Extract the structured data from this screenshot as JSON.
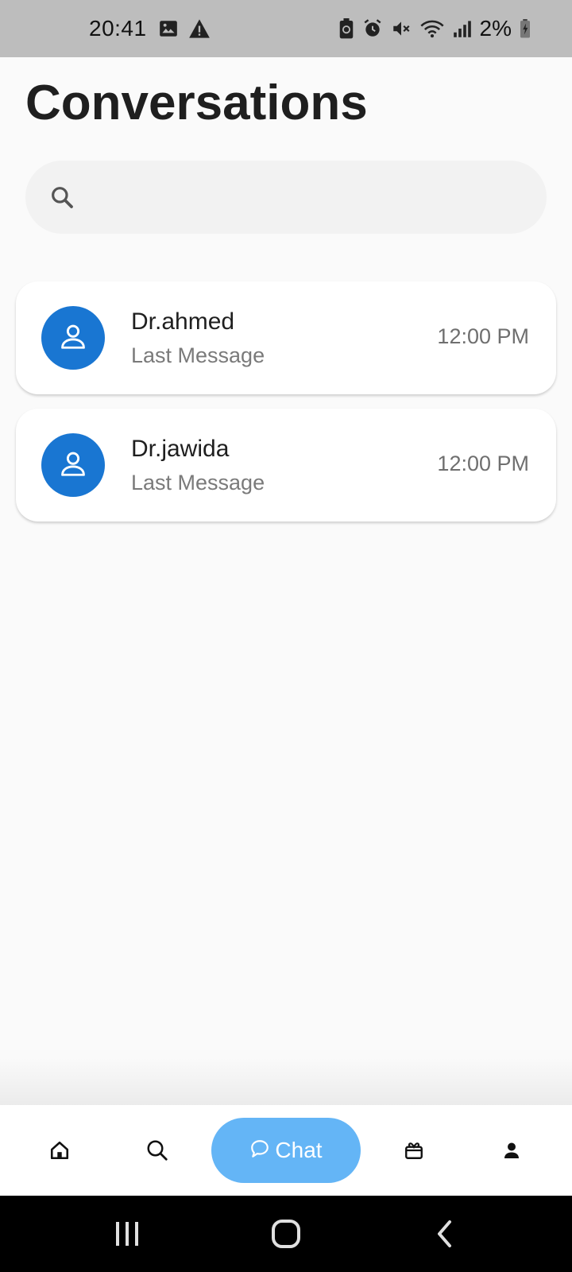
{
  "status_bar": {
    "time": "20:41",
    "battery_text": "2%",
    "left_icons": [
      "image-icon",
      "warning-icon"
    ],
    "right_icons": [
      "battery-saver-icon",
      "alarm-icon",
      "mute-icon",
      "wifi-icon",
      "signal-icon",
      "battery-icon"
    ]
  },
  "page": {
    "title": "Conversations"
  },
  "search": {
    "icon": "search-icon",
    "placeholder": "",
    "value": ""
  },
  "conversations": [
    {
      "name": "Dr.ahmed",
      "last_message": "Last Message",
      "time": "12:00 PM",
      "avatar_icon": "person-icon"
    },
    {
      "name": "Dr.jawida",
      "last_message": "Last Message",
      "time": "12:00 PM",
      "avatar_icon": "person-icon"
    }
  ],
  "bottom_nav": {
    "items": [
      {
        "icon": "home-icon"
      },
      {
        "icon": "search-icon"
      },
      {
        "icon": "chat-bubble-icon",
        "label": "Chat",
        "active": true
      },
      {
        "icon": "gift-icon"
      },
      {
        "icon": "profile-icon"
      }
    ]
  },
  "system_nav": {
    "buttons": [
      "recents-icon",
      "home-circle-icon",
      "back-icon"
    ]
  },
  "colors": {
    "status_bar_bg": "#bdbdbd",
    "page_bg": "#fafafa",
    "avatar_bg": "#1976d2",
    "active_nav_pill": "#64b5f6",
    "system_nav_bg": "#000000"
  }
}
